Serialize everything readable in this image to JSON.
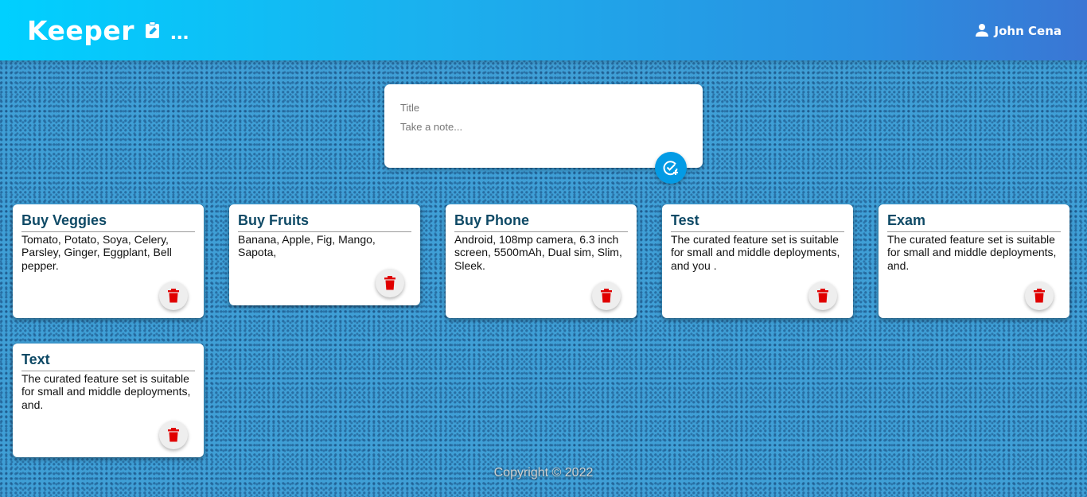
{
  "header": {
    "brand": "Keeper",
    "brand_icon": "note-add-icon",
    "brand_suffix": "...",
    "user_icon": "person-icon",
    "user_name": "John Cena"
  },
  "create_note": {
    "title_placeholder": "Title",
    "content_placeholder": "Take a note...",
    "title_value": "",
    "content_value": "",
    "add_icon": "add-task-icon"
  },
  "notes": [
    {
      "title": "Buy Veggies",
      "content": "Tomato, Potato, Soya, Celery, Parsley, Ginger, Eggplant, Bell pepper."
    },
    {
      "title": "Buy Fruits",
      "content": "Banana, Apple, Fig, Mango, Sapota,"
    },
    {
      "title": "Buy Phone",
      "content": "Android, 108mp camera, 6.3 inch screen, 5500mAh, Dual sim, Slim, Sleek."
    },
    {
      "title": "Test",
      "content": "The curated feature set is suitable for small and middle deployments, and you ."
    },
    {
      "title": "Exam",
      "content": "The curated feature set is suitable for small and middle deployments, and."
    },
    {
      "title": "Text",
      "content": "The curated feature set is suitable for small and middle deployments, and."
    }
  ],
  "delete_icon": "trash-icon",
  "footer": {
    "copyright": "Copyright © 2022"
  },
  "colors": {
    "header_gradient_start": "#00d0ff",
    "header_gradient_end": "#3a76d4",
    "accent": "#039be5",
    "title_color": "#0f4a66",
    "delete_icon_color": "#e00000"
  }
}
